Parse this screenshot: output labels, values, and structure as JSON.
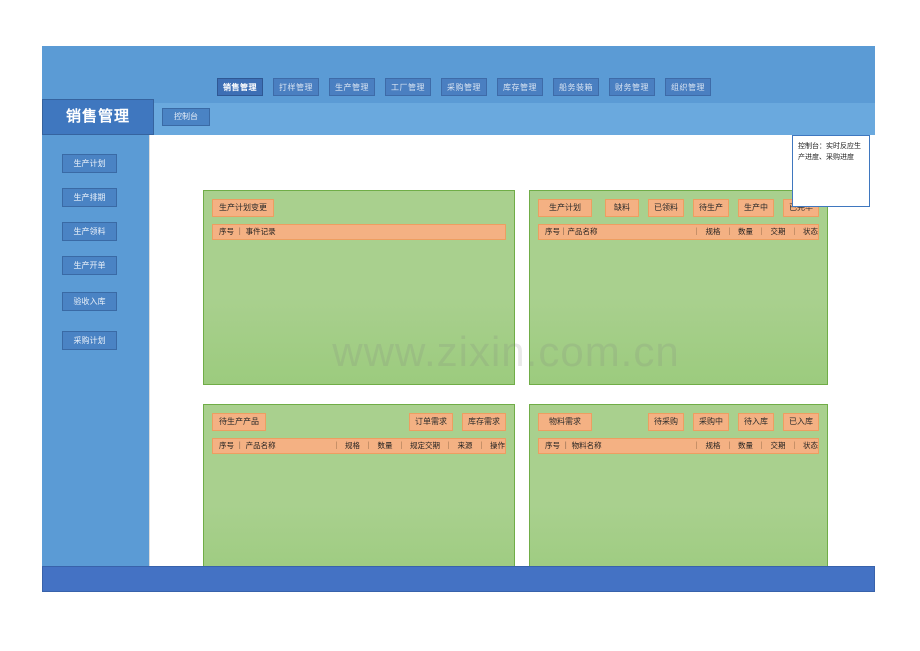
{
  "top_nav": {
    "items": [
      {
        "label": "销售管理",
        "active": true
      },
      {
        "label": "打样管理",
        "active": false
      },
      {
        "label": "生产管理",
        "active": false
      },
      {
        "label": "工厂管理",
        "active": false
      },
      {
        "label": "采购管理",
        "active": false
      },
      {
        "label": "库存管理",
        "active": false
      },
      {
        "label": "船务装箱",
        "active": false
      },
      {
        "label": "财务管理",
        "active": false
      },
      {
        "label": "组织管理",
        "active": false
      }
    ]
  },
  "module": {
    "title": "销售管理",
    "tabs": [
      {
        "label": "控制台"
      }
    ]
  },
  "sidebar": {
    "items": [
      {
        "label": "生产计划"
      },
      {
        "label": "生产排期"
      },
      {
        "label": "生产领料"
      },
      {
        "label": "生产开单"
      },
      {
        "label": "验收入库"
      },
      {
        "label": "采购计划"
      }
    ]
  },
  "note": {
    "text": "控制台：实时反应生产进度、采购进度"
  },
  "panels": {
    "plan_change": {
      "title": "生产计划变更",
      "filters": [],
      "columns_first": "序号 ｜ 事件记录",
      "columns_rest": []
    },
    "production_plan": {
      "title": "生产计划",
      "filters": [
        "缺料",
        "已领料",
        "待生产",
        "生产中",
        "已完毕"
      ],
      "columns_first": "序号｜产品名称",
      "columns_rest": [
        "规格",
        "数量",
        "交期",
        "状态"
      ]
    },
    "pending_products": {
      "title": "待生产产品",
      "filters": [
        "订单需求",
        "库存需求"
      ],
      "columns_first": "序号 ｜ 产品名称",
      "columns_rest": [
        "规格",
        "数量",
        "规定交期",
        "来源",
        "操作"
      ]
    },
    "material_demand": {
      "title": "物料需求",
      "filters": [
        "待采购",
        "采购中",
        "待入库",
        "已入库"
      ],
      "columns_first": "序号 ｜ 物料名称",
      "columns_rest": [
        "规格",
        "数量",
        "交期",
        "状态"
      ]
    }
  },
  "watermark": {
    "text": "www.zixin.com.cn"
  },
  "colors": {
    "brand_blue": "#5b9bd5",
    "nav_active_blue": "#3d6fb5",
    "panel_green": "#a9d08e",
    "panel_border_green": "#70ad47",
    "accent_orange": "#f4b183",
    "bottom_bar_blue": "#4472c4"
  }
}
